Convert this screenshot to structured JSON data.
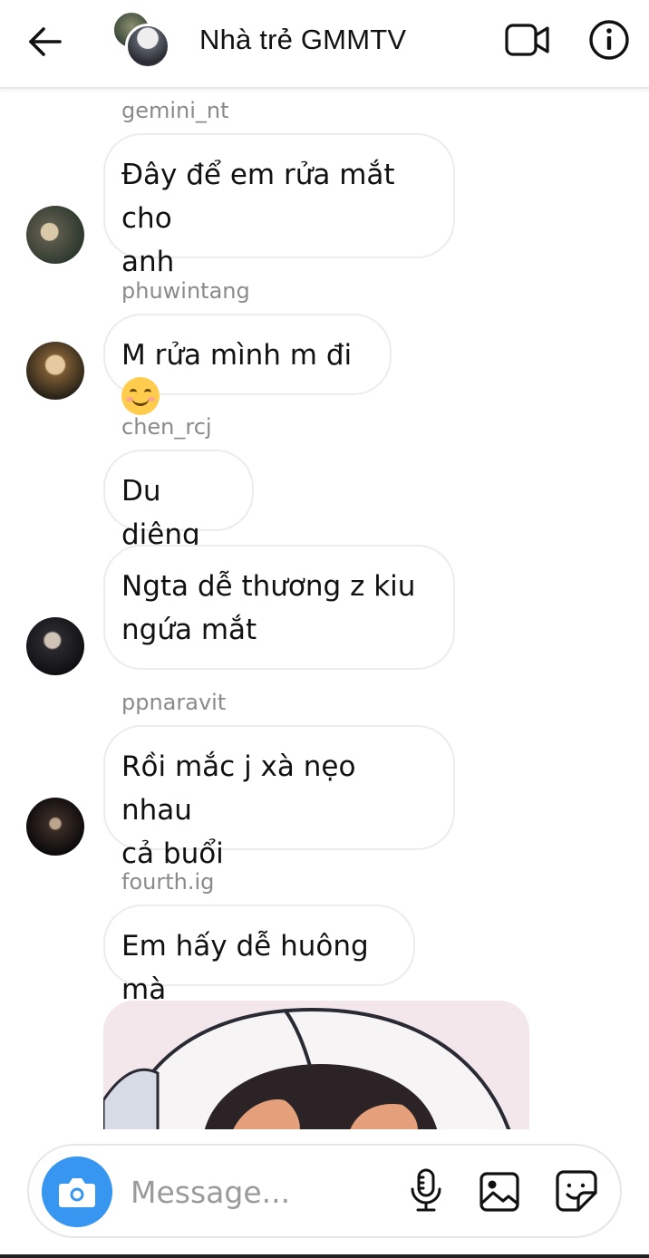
{
  "header": {
    "title": "Nhà trẻ GMMTV",
    "back_icon": "arrow-left-icon",
    "video_icon": "video-camera-icon",
    "info_icon": "info-icon"
  },
  "messages": [
    {
      "sender": "gemini_nt",
      "lines": [
        "Đây để em rửa mắt cho",
        "anh"
      ]
    },
    {
      "sender": "phuwintang",
      "text": "M rửa mình m đi",
      "emoji": "smiling-face-icon"
    },
    {
      "sender": "chen_rcj",
      "lines": [
        "Du diêng"
      ]
    },
    {
      "sender": "",
      "lines": [
        "Ngta dễ thương z kiu",
        "ngứa mắt"
      ]
    },
    {
      "sender": "ppnaravit",
      "lines": [
        "Rồi mắc j xà nẹo nhau",
        "cả buổi"
      ]
    },
    {
      "sender": "fourth.ig",
      "lines": [
        "Em hấy dễ huông mà"
      ]
    }
  ],
  "composer": {
    "placeholder": "Message...",
    "camera_icon": "camera-icon",
    "mic_icon": "microphone-icon",
    "gallery_icon": "gallery-icon",
    "sticker_icon": "sticker-icon"
  },
  "colors": {
    "accent": "#3797f0",
    "bubble_border": "#ececec",
    "sender_text": "#8a8a8a"
  }
}
